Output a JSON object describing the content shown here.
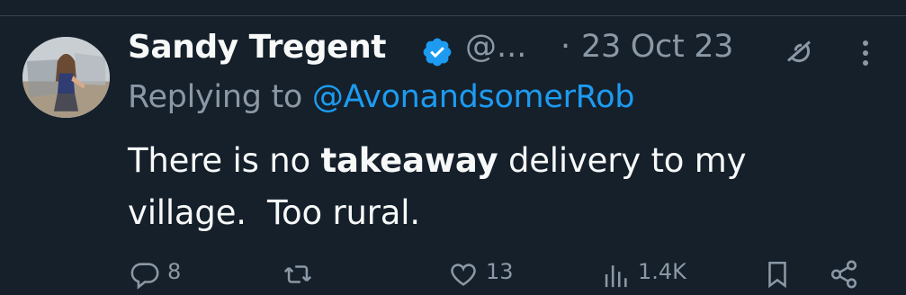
{
  "tweet": {
    "author_name": "Sandy Tregent",
    "handle": "@...",
    "separator": "·",
    "timestamp": "23 Oct 23",
    "replying_prefix": "Replying to ",
    "replying_to": "@AvonandsomerRob",
    "text_1": "There is no ",
    "text_bold": "takeaway",
    "text_2": " delivery to my\nvillage.  Too rural.",
    "verified": true
  },
  "actions": {
    "replies": "8",
    "retweets": "",
    "likes": "13",
    "views": "1.4K"
  },
  "colors": {
    "background": "#15202b",
    "text": "#f7f9f9",
    "muted": "#8b98a5",
    "accent": "#1d9bf0"
  },
  "icons": [
    "verified-badge-icon",
    "grok-icon",
    "more-icon",
    "reply-icon",
    "retweet-icon",
    "like-icon",
    "views-icon",
    "bookmark-icon",
    "share-icon"
  ]
}
